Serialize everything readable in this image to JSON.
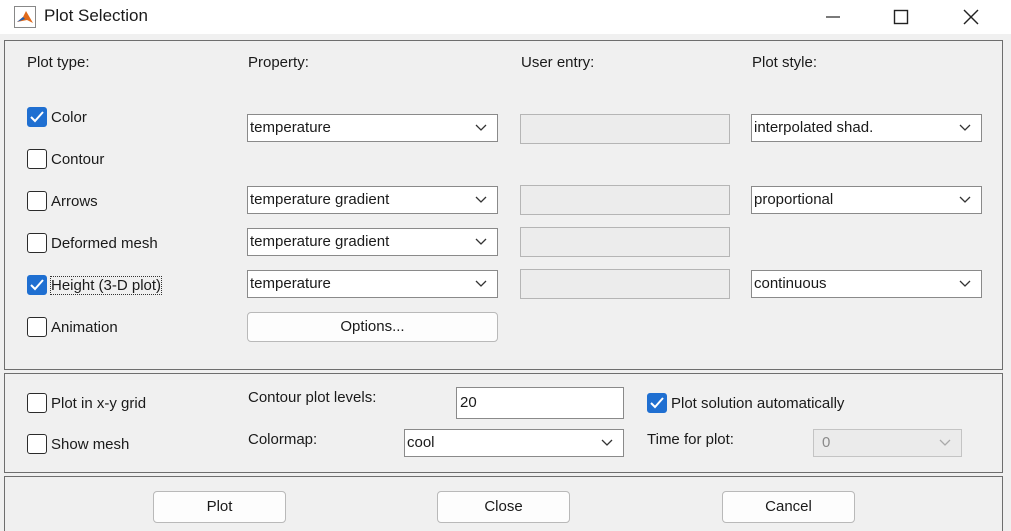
{
  "window": {
    "title": "Plot Selection"
  },
  "headers": {
    "plot_type": "Plot type:",
    "property": "Property:",
    "user_entry": "User entry:",
    "plot_style": "Plot style:"
  },
  "rows": {
    "color": {
      "label": "Color",
      "checked": true,
      "property": "temperature",
      "style": "interpolated shad."
    },
    "contour": {
      "label": "Contour",
      "checked": false
    },
    "arrows": {
      "label": "Arrows",
      "checked": false,
      "property": "temperature gradient",
      "style": "proportional"
    },
    "deformed": {
      "label": "Deformed mesh",
      "checked": false,
      "property": "temperature gradient"
    },
    "height": {
      "label": "Height (3-D plot)",
      "checked": true,
      "property": "temperature",
      "style": "continuous"
    },
    "animation": {
      "label": "Animation",
      "checked": false,
      "options_label": "Options..."
    }
  },
  "options": {
    "xy_grid": {
      "label": "Plot in x-y grid",
      "checked": false
    },
    "show_mesh": {
      "label": "Show mesh",
      "checked": false
    },
    "contour_levels": {
      "label": "Contour plot levels:",
      "value": "20"
    },
    "colormap": {
      "label": "Colormap:",
      "value": "cool"
    },
    "auto_plot": {
      "label": "Plot solution automatically",
      "checked": true
    },
    "time_for_plot": {
      "label": "Time for plot:",
      "value": "0"
    }
  },
  "buttons": {
    "plot": "Plot",
    "close": "Close",
    "cancel": "Cancel"
  },
  "colors": {
    "accent": "#1f6fd1",
    "panel_border": "#6e6e6e",
    "background": "#f0f0f0"
  },
  "icons": [
    "matlab-logo-icon",
    "minimize-icon",
    "maximize-icon",
    "close-icon",
    "checkmark-icon",
    "chevron-down-icon"
  ]
}
